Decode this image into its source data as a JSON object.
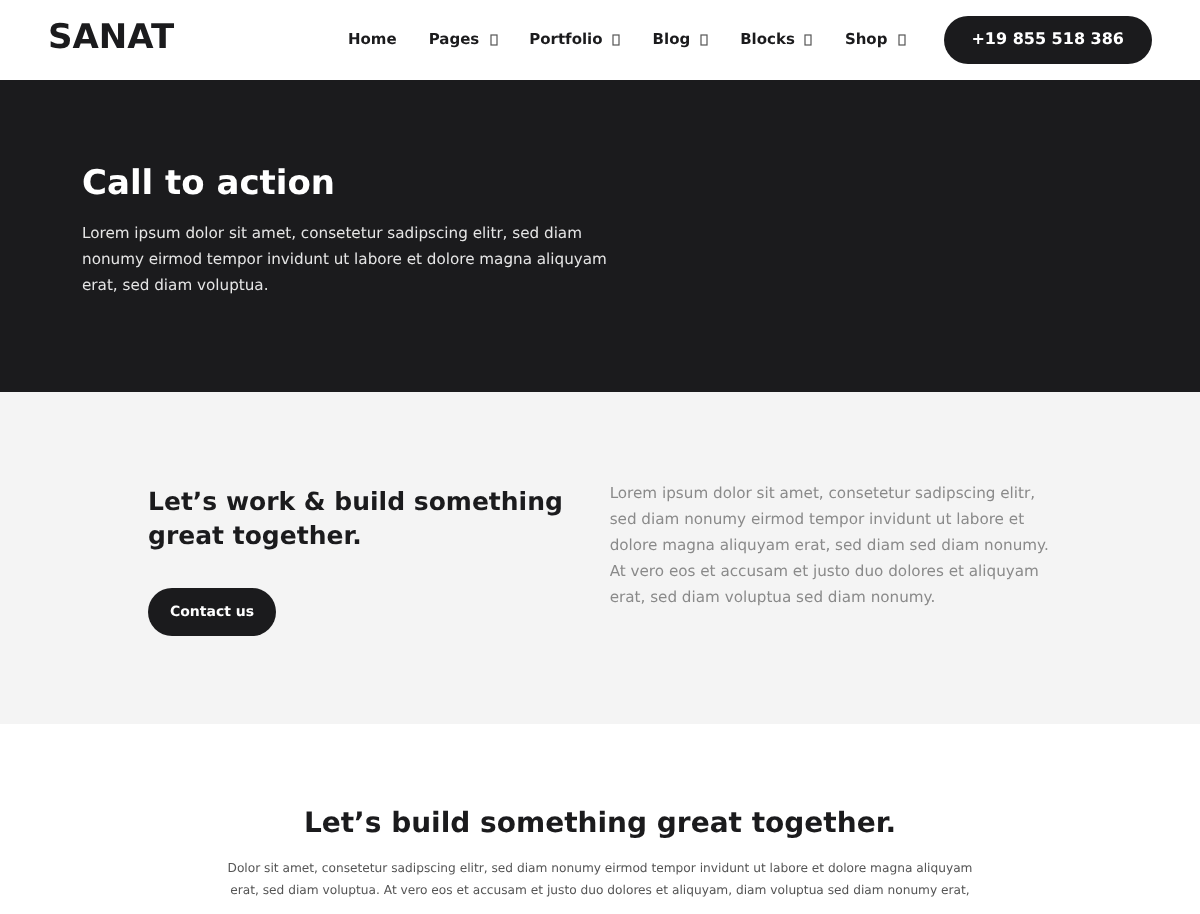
{
  "header": {
    "logo": "SANAT",
    "nav": [
      {
        "label": "Home",
        "has_menu": false
      },
      {
        "label": "Pages",
        "has_menu": true
      },
      {
        "label": "Portfolio",
        "has_menu": true
      },
      {
        "label": "Blog",
        "has_menu": true
      },
      {
        "label": "Blocks",
        "has_menu": true
      },
      {
        "label": "Shop",
        "has_menu": true
      }
    ],
    "phone_button": "+19 855 518 386"
  },
  "hero": {
    "title": "Call to action",
    "text": "Lorem ipsum dolor sit amet, consetetur sadipscing elitr, sed diam nonumy eirmod tempor invidunt ut labore et dolore magna aliquyam erat, sed diam voluptua."
  },
  "cta": {
    "title": "Let’s work & build something great together.",
    "button": "Contact us",
    "text": "Lorem ipsum dolor sit amet, consetetur sadipscing elitr, sed diam nonumy eirmod tempor invidunt ut labore et dolore magna aliquyam erat, sed diam sed diam nonumy. At vero eos et accusam et justo duo dolores et aliquyam erat, sed diam voluptua sed diam nonumy."
  },
  "closing": {
    "title": "Let’s build something great together.",
    "text": "Dolor sit amet, consetetur sadipscing elitr, sed diam nonumy eirmod tempor invidunt ut labore et dolore magna aliquyam erat, sed diam voluptua. At vero eos et accusam et justo duo dolores et aliquyam, diam voluptua sed diam nonumy erat,"
  }
}
